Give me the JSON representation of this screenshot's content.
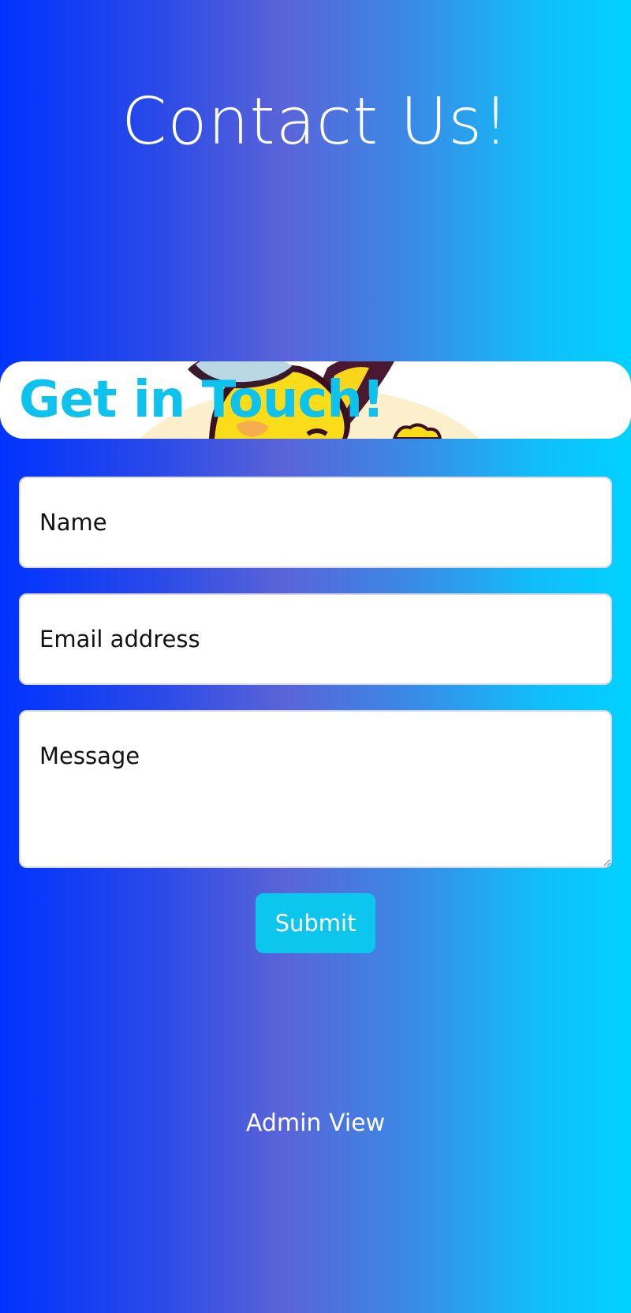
{
  "header": {
    "title": "Contact Us!"
  },
  "banner": {
    "heading": "Get in Touch!",
    "image": "pikachu-cartoon-illustration"
  },
  "form": {
    "name_placeholder": "Name",
    "email_placeholder": "Email address",
    "message_placeholder": "Message",
    "submit_label": "Submit"
  },
  "footer": {
    "admin_link_label": "Admin View"
  },
  "colors": {
    "gradient_left": "#0033ff",
    "gradient_mid": "#5a64d8",
    "gradient_right": "#00d2ff",
    "accent": "#0dc6ee",
    "text_light": "#ffffff"
  }
}
